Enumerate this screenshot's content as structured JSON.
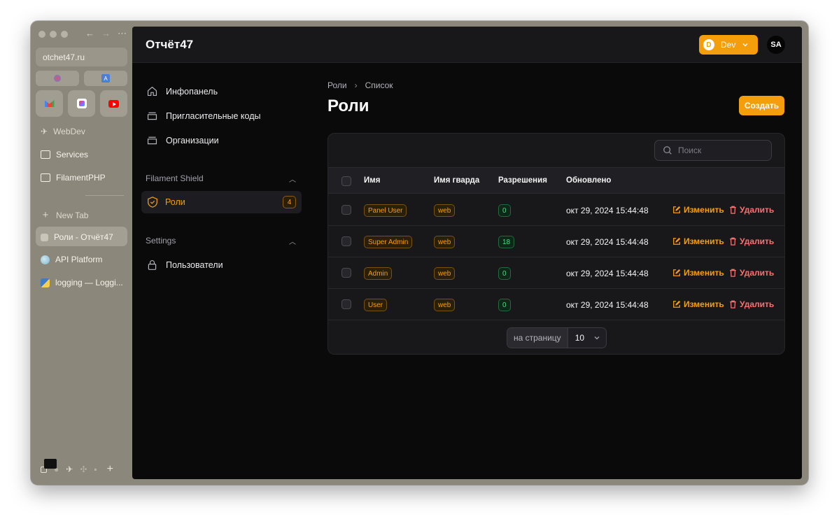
{
  "browser": {
    "url": "otchet47.ru",
    "spaces": [
      "WebDev"
    ],
    "folders": [
      "Services",
      "FilamentPHP"
    ],
    "new_tab": "New Tab",
    "tabs": [
      "Роли - Отчёт47",
      "API Platform",
      "logging — Loggi..."
    ]
  },
  "app": {
    "brand": "Отчёт47",
    "tenant": {
      "initial": "D",
      "label": "Dev"
    },
    "user_initials": "SA"
  },
  "sidebar": {
    "items": [
      {
        "label": "Инфопанель",
        "icon": "home-icon"
      },
      {
        "label": "Пригласительные коды",
        "icon": "inbox-icon"
      },
      {
        "label": "Организации",
        "icon": "inbox-icon"
      }
    ],
    "groups": [
      {
        "label": "Filament Shield",
        "items": [
          {
            "label": "Роли",
            "badge": "4",
            "icon": "shield-check-icon",
            "active": true
          }
        ]
      },
      {
        "label": "Settings",
        "items": [
          {
            "label": "Пользователи",
            "icon": "lock-icon"
          }
        ]
      }
    ]
  },
  "page": {
    "breadcrumb": [
      "Роли",
      "Список"
    ],
    "title": "Роли",
    "create_label": "Создать"
  },
  "table": {
    "search_placeholder": "Поиск",
    "columns": [
      "Имя",
      "Имя гварда",
      "Разрешения",
      "Обновлено"
    ],
    "rows": [
      {
        "name": "Panel User",
        "guard": "web",
        "permissions": "0",
        "updated": "окт 29, 2024 15:44:48"
      },
      {
        "name": "Super Admin",
        "guard": "web",
        "permissions": "18",
        "updated": "окт 29, 2024 15:44:48"
      },
      {
        "name": "Admin",
        "guard": "web",
        "permissions": "0",
        "updated": "окт 29, 2024 15:44:48"
      },
      {
        "name": "User",
        "guard": "web",
        "permissions": "0",
        "updated": "окт 29, 2024 15:44:48"
      }
    ],
    "edit_label": "Изменить",
    "delete_label": "Удалить",
    "per_page_label": "на страницу",
    "per_page_value": "10"
  },
  "colors": {
    "accent": "#f59e0b",
    "danger": "#f87171",
    "success": "#4ade80"
  }
}
